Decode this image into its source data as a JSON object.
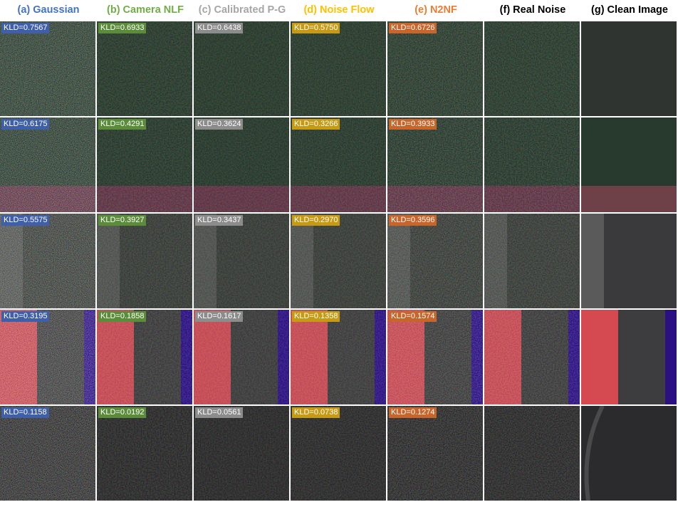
{
  "columns": [
    {
      "title": "(a) Gaussian",
      "color": "#4472c4",
      "label_bg": "#3f5fa8"
    },
    {
      "title": "(b) Camera NLF",
      "color": "#70ad47",
      "label_bg": "#5b8c3a"
    },
    {
      "title": "(c) Calibrated P-G",
      "color": "#a6a6a6",
      "label_bg": "#8c8c8c"
    },
    {
      "title": "(d) Noise Flow",
      "color": "#ffc000",
      "label_bg": "#c79a14"
    },
    {
      "title": "(e) N2NF",
      "color": "#ed7d31",
      "label_bg": "#c7652a"
    },
    {
      "title": "(f) Real Noise",
      "color": "#000000",
      "label_bg": ""
    },
    {
      "title": "(g) Clean Image",
      "color": "#000000",
      "label_bg": ""
    }
  ],
  "rows": [
    {
      "kld": [
        "KLD=0.7567",
        "KLD=0.6933",
        "KLD=0.6438",
        "KLD=0.5750",
        "KLD=0.6726"
      ]
    },
    {
      "kld": [
        "KLD=0.6175",
        "KLD=0.4291",
        "KLD=0.3624",
        "KLD=0.3266",
        "KLD=0.3933"
      ]
    },
    {
      "kld": [
        "KLD=0.5575",
        "KLD=0.3927",
        "KLD=0.3437",
        "KLD=0.2970",
        "KLD=0.3596"
      ]
    },
    {
      "kld": [
        "KLD=0.3195",
        "KLD=0.1858",
        "KLD=0.1617",
        "KLD=0.1358",
        "KLD=0.1574"
      ]
    },
    {
      "kld": [
        "KLD=0.1158",
        "KLD=0.0192",
        "KLD=0.0561",
        "KLD=0.0738",
        "KLD=0.1274"
      ]
    }
  ]
}
